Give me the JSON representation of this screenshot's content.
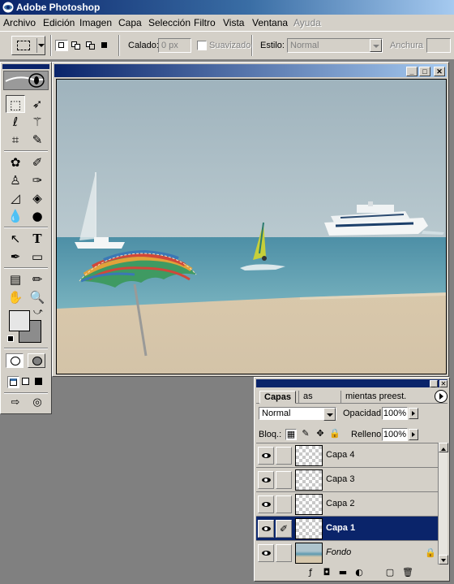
{
  "app": {
    "title": "Adobe Photoshop"
  },
  "menu": [
    "Archivo",
    "Edición",
    "Imagen",
    "Capa",
    "Selección",
    "Filtro",
    "Vista",
    "Ventana",
    "Ayuda"
  ],
  "options": {
    "feather_label": "Calado:",
    "feather_value": "0 px",
    "antialias_label": "Suavizado",
    "style_label": "Estilo:",
    "style_value": "Normal",
    "width_label": "Anchura"
  },
  "document": {
    "window_buttons": [
      "_",
      "□",
      "✕"
    ],
    "scene": "photo-beach-umbrella-ferry-windsurfer"
  },
  "layers_palette": {
    "tabs": [
      "Capas",
      "as",
      "mientas preest."
    ],
    "blend_mode": "Normal",
    "opacity_label": "Opacidad:",
    "opacity_value": "100%",
    "lock_label": "Bloq.:",
    "fill_label": "Relleno:",
    "fill_value": "100%",
    "layers": [
      {
        "name": "Capa 4",
        "visible": true,
        "selected": false
      },
      {
        "name": "Capa 3",
        "visible": true,
        "selected": false
      },
      {
        "name": "Capa 2",
        "visible": true,
        "selected": false
      },
      {
        "name": "Capa 1",
        "visible": true,
        "selected": true
      },
      {
        "name": "Fondo",
        "visible": true,
        "selected": false,
        "locked": true
      }
    ]
  },
  "colors": {
    "title_gradient_start": "#0a246a",
    "title_gradient_end": "#a6caf0",
    "chrome": "#d4d0c8",
    "workspace": "#808080",
    "selected_layer": "#0a246a",
    "foreground_color": "#e6e6e6",
    "background_color": "#8c8c8c"
  }
}
